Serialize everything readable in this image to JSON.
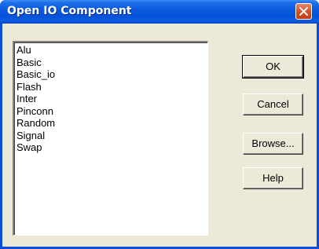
{
  "window": {
    "title": "Open IO Component"
  },
  "list": {
    "items": [
      "Alu",
      "Basic",
      "Basic_io",
      "Flash",
      "Inter",
      "Pinconn",
      "Random",
      "Signal",
      "Swap"
    ]
  },
  "buttons": {
    "ok_label": "OK",
    "cancel_label": "Cancel",
    "browse_label": "Browse...",
    "help_label": "Help"
  },
  "icons": {
    "close": "close-icon"
  },
  "colors": {
    "titlebar": "#0a5ae0",
    "dialog_face": "#ece9d8",
    "close_button": "#d9532b"
  }
}
